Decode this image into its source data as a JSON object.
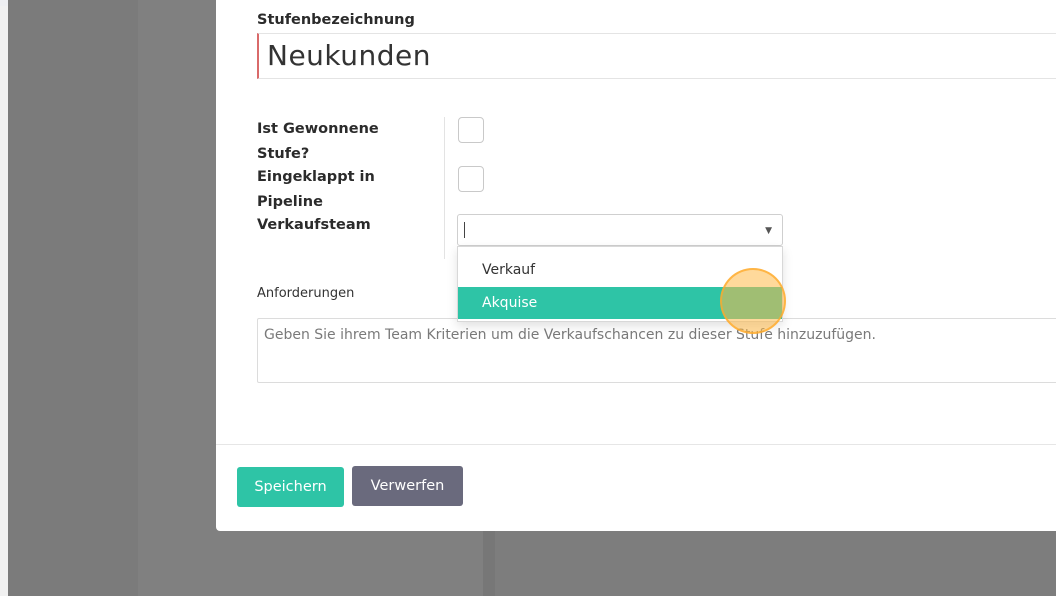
{
  "form": {
    "stage_name_label": "Stufenbezeichnung",
    "stage_name_value": "Neukunden",
    "is_won_label_line1": "Ist Gewonnene",
    "is_won_label_line2": "Stufe?",
    "folded_label_line1": "Eingeklappt in",
    "folded_label_line2": "Pipeline",
    "sales_team_label": "Verkaufsteam",
    "sales_team_value": "",
    "sales_team_options": [
      "Verkauf",
      "Akquise"
    ],
    "sales_team_highlighted": "Akquise",
    "requirements_label": "Anforderungen",
    "requirements_placeholder": "Geben Sie ihrem Team Kriterien um die Verkaufschancen zu dieser Stufe hinzuzufügen."
  },
  "footer": {
    "save_label": "Speichern",
    "discard_label": "Verwerfen"
  },
  "colors": {
    "accent": "#2ec4a6",
    "secondary_button": "#6a6a7d",
    "required_marker": "#d96a6a",
    "click_indicator": "#ffba49"
  },
  "icons": {
    "dropdown": "chevron-down-icon"
  }
}
